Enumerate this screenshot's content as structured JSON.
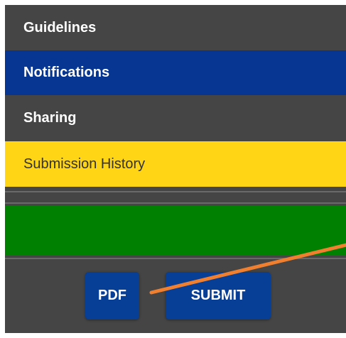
{
  "menu": {
    "items": [
      {
        "label": "Guidelines"
      },
      {
        "label": "Notifications"
      },
      {
        "label": "Sharing"
      },
      {
        "label": "Submission History"
      }
    ]
  },
  "actions": {
    "pdf_label": "PDF",
    "submit_label": "SUBMIT"
  },
  "colors": {
    "panel_bg": "#454545",
    "notifications_bg": "#063691",
    "history_bg": "#ffd516",
    "status_bar": "#008001",
    "button_bg": "#073e96",
    "annotation_arrow": "#f08030"
  }
}
